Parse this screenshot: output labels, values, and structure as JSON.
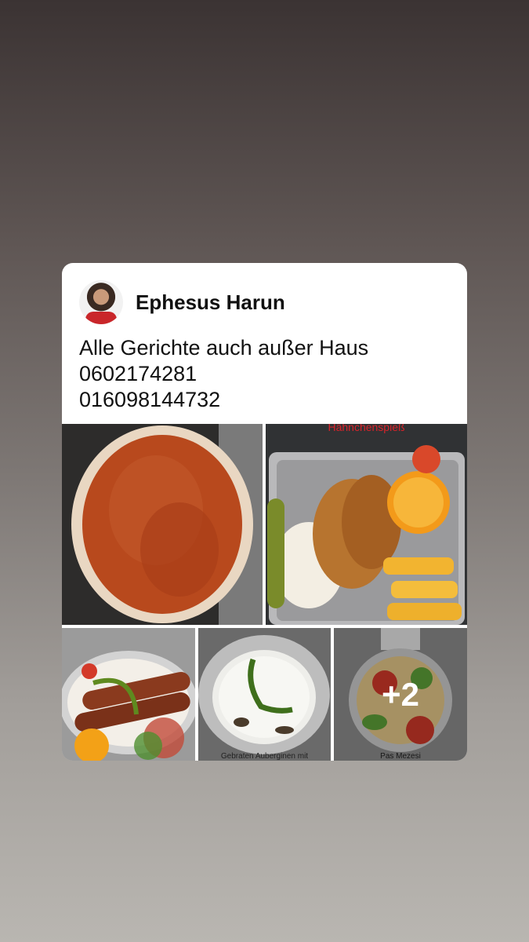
{
  "post": {
    "author": "Ephesus Harun",
    "text_lines": [
      "Alle Gerichte auch außer Haus",
      "0602174281",
      "016098144732"
    ]
  },
  "photos": {
    "photo2_caption": "Hähnchenspieß",
    "photo4_caption": "Gebraten Auberginen mit",
    "photo5_caption": "Pas Mezesi",
    "more_count": "+2"
  }
}
